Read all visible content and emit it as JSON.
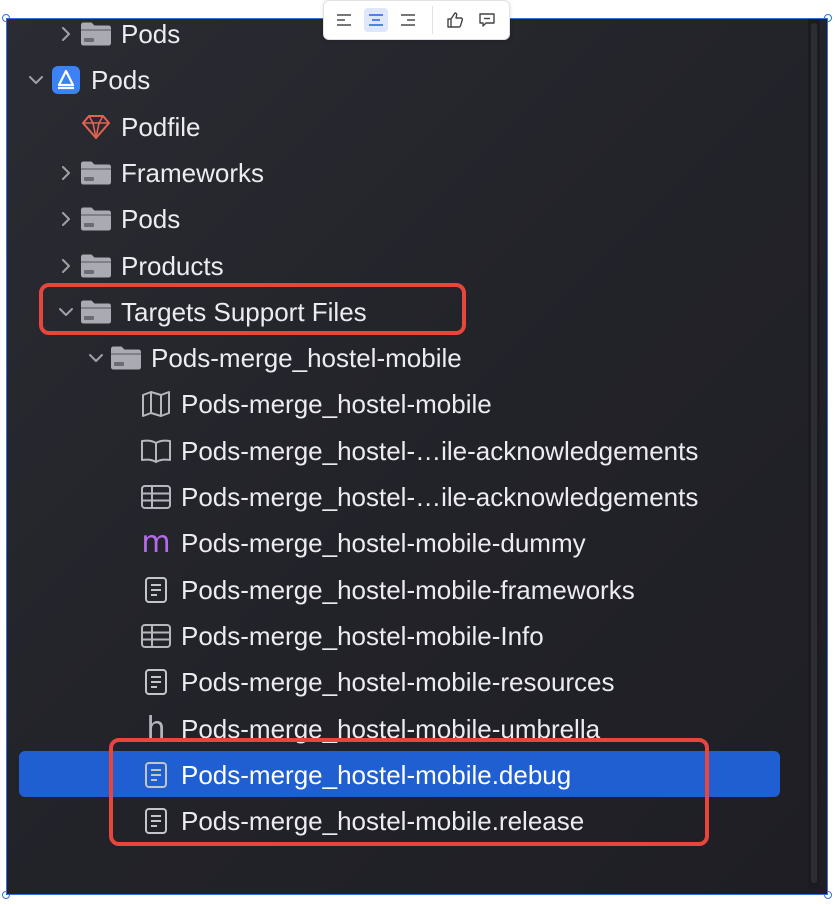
{
  "toolbar": {
    "buttons": [
      "align-left-icon",
      "align-center-icon",
      "align-right-icon",
      "thumbs-up-icon",
      "comment-icon"
    ],
    "active": "align-center-icon"
  },
  "navigator": {
    "rows": [
      {
        "label": "Pods",
        "icon": "folder-icon",
        "disclosure": "collapsed",
        "depth": 1
      },
      {
        "label": "Pods",
        "icon": "xcode-project-icon",
        "disclosure": "expanded",
        "depth": 0
      },
      {
        "label": "Podfile",
        "icon": "ruby-gem-icon",
        "disclosure": "none",
        "depth": 1
      },
      {
        "label": "Frameworks",
        "icon": "folder-icon",
        "disclosure": "collapsed",
        "depth": 1
      },
      {
        "label": "Pods",
        "icon": "folder-icon",
        "disclosure": "collapsed",
        "depth": 1
      },
      {
        "label": "Products",
        "icon": "folder-icon",
        "disclosure": "collapsed",
        "depth": 1
      },
      {
        "label": "Targets Support Files",
        "icon": "folder-icon",
        "disclosure": "expanded",
        "depth": 1
      },
      {
        "label": "Pods-merge_hostel-mobile",
        "icon": "folder-icon",
        "disclosure": "expanded",
        "depth": 2
      },
      {
        "label": "Pods-merge_hostel-mobile",
        "icon": "module-map-icon",
        "disclosure": "none",
        "depth": 3
      },
      {
        "label": "Pods-merge_hostel-…ile-acknowledgements",
        "icon": "book-icon",
        "disclosure": "none",
        "depth": 3
      },
      {
        "label": "Pods-merge_hostel-…ile-acknowledgements",
        "icon": "plist-icon",
        "disclosure": "none",
        "depth": 3
      },
      {
        "label": "Pods-merge_hostel-mobile-dummy",
        "icon": "objc-m-file-icon",
        "disclosure": "none",
        "depth": 3
      },
      {
        "label": "Pods-merge_hostel-mobile-frameworks",
        "icon": "text-file-icon",
        "disclosure": "none",
        "depth": 3
      },
      {
        "label": "Pods-merge_hostel-mobile-Info",
        "icon": "plist-icon",
        "disclosure": "none",
        "depth": 3
      },
      {
        "label": "Pods-merge_hostel-mobile-resources",
        "icon": "text-file-icon",
        "disclosure": "none",
        "depth": 3
      },
      {
        "label": "Pods-merge_hostel-mobile-umbrella",
        "icon": "header-h-file-icon",
        "disclosure": "none",
        "depth": 3
      },
      {
        "label": "Pods-merge_hostel-mobile.debug",
        "icon": "text-file-icon",
        "disclosure": "none",
        "depth": 3,
        "selected": true
      },
      {
        "label": "Pods-merge_hostel-mobile.release",
        "icon": "text-file-icon",
        "disclosure": "none",
        "depth": 3
      }
    ]
  },
  "colors": {
    "selection": "#1f5fd1",
    "highlight_box": "#e8453c",
    "folder": "#a9aab2",
    "project": "#3b82f6",
    "gem": "#e0644f",
    "m_file": "#b46be8"
  }
}
